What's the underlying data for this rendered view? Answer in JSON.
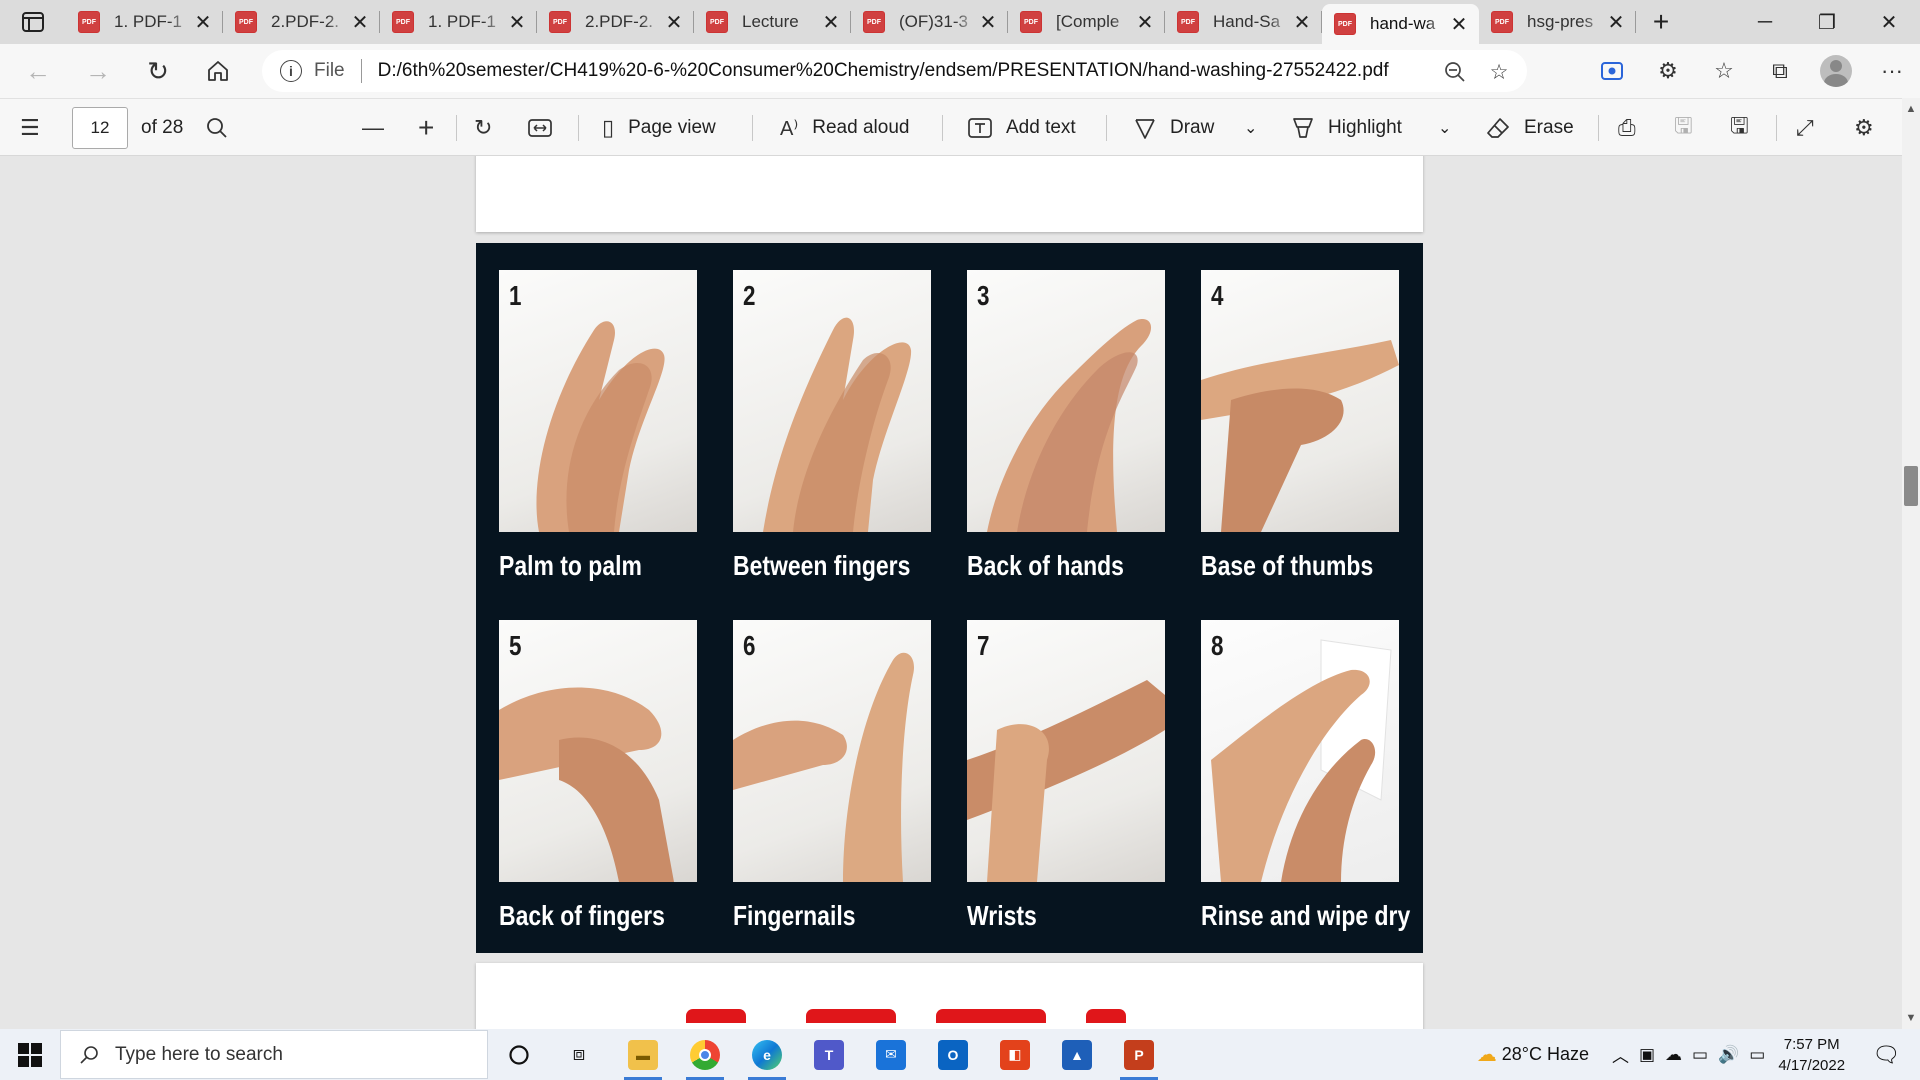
{
  "browser": {
    "tabs": [
      {
        "title": "1. PDF-1"
      },
      {
        "title": "2.PDF-2."
      },
      {
        "title": "1. PDF-1"
      },
      {
        "title": "2.PDF-2."
      },
      {
        "title": "Lecture"
      },
      {
        "title": "(OF)31-3"
      },
      {
        "title": "[Comple"
      },
      {
        "title": "Hand-Sa"
      },
      {
        "title": "hand-wa"
      },
      {
        "title": "hsg-pres"
      }
    ],
    "active_tab_index": 8,
    "address": {
      "scheme": "File",
      "url": "D:/6th%20semester/CH419%20-6-%20Consumer%20Chemistry/endsem/PRESENTATION/hand-washing-27552422.pdf"
    }
  },
  "pdf_toolbar": {
    "page_number": "12",
    "page_total": "of 28",
    "page_view": "Page view",
    "read_aloud": "Read aloud",
    "add_text": "Add text",
    "draw": "Draw",
    "highlight": "Highlight",
    "erase": "Erase"
  },
  "document": {
    "steps": [
      {
        "num": "1",
        "caption": "Palm to palm"
      },
      {
        "num": "2",
        "caption": "Between fingers"
      },
      {
        "num": "3",
        "caption": "Back of hands"
      },
      {
        "num": "4",
        "caption": "Base of thumbs"
      },
      {
        "num": "5",
        "caption": "Back of fingers"
      },
      {
        "num": "6",
        "caption": "Fingernails"
      },
      {
        "num": "7",
        "caption": "Wrists"
      },
      {
        "num": "8",
        "caption": "Rinse and wipe dry"
      }
    ]
  },
  "taskbar": {
    "search_placeholder": "Type here to search",
    "weather": "28°C  Haze",
    "time": "7:57 PM",
    "date": "4/17/2022"
  },
  "colors": {
    "infographic_bg": "#06141f",
    "next_page_heading": "#e0161a",
    "skin": "#d9a27e"
  }
}
